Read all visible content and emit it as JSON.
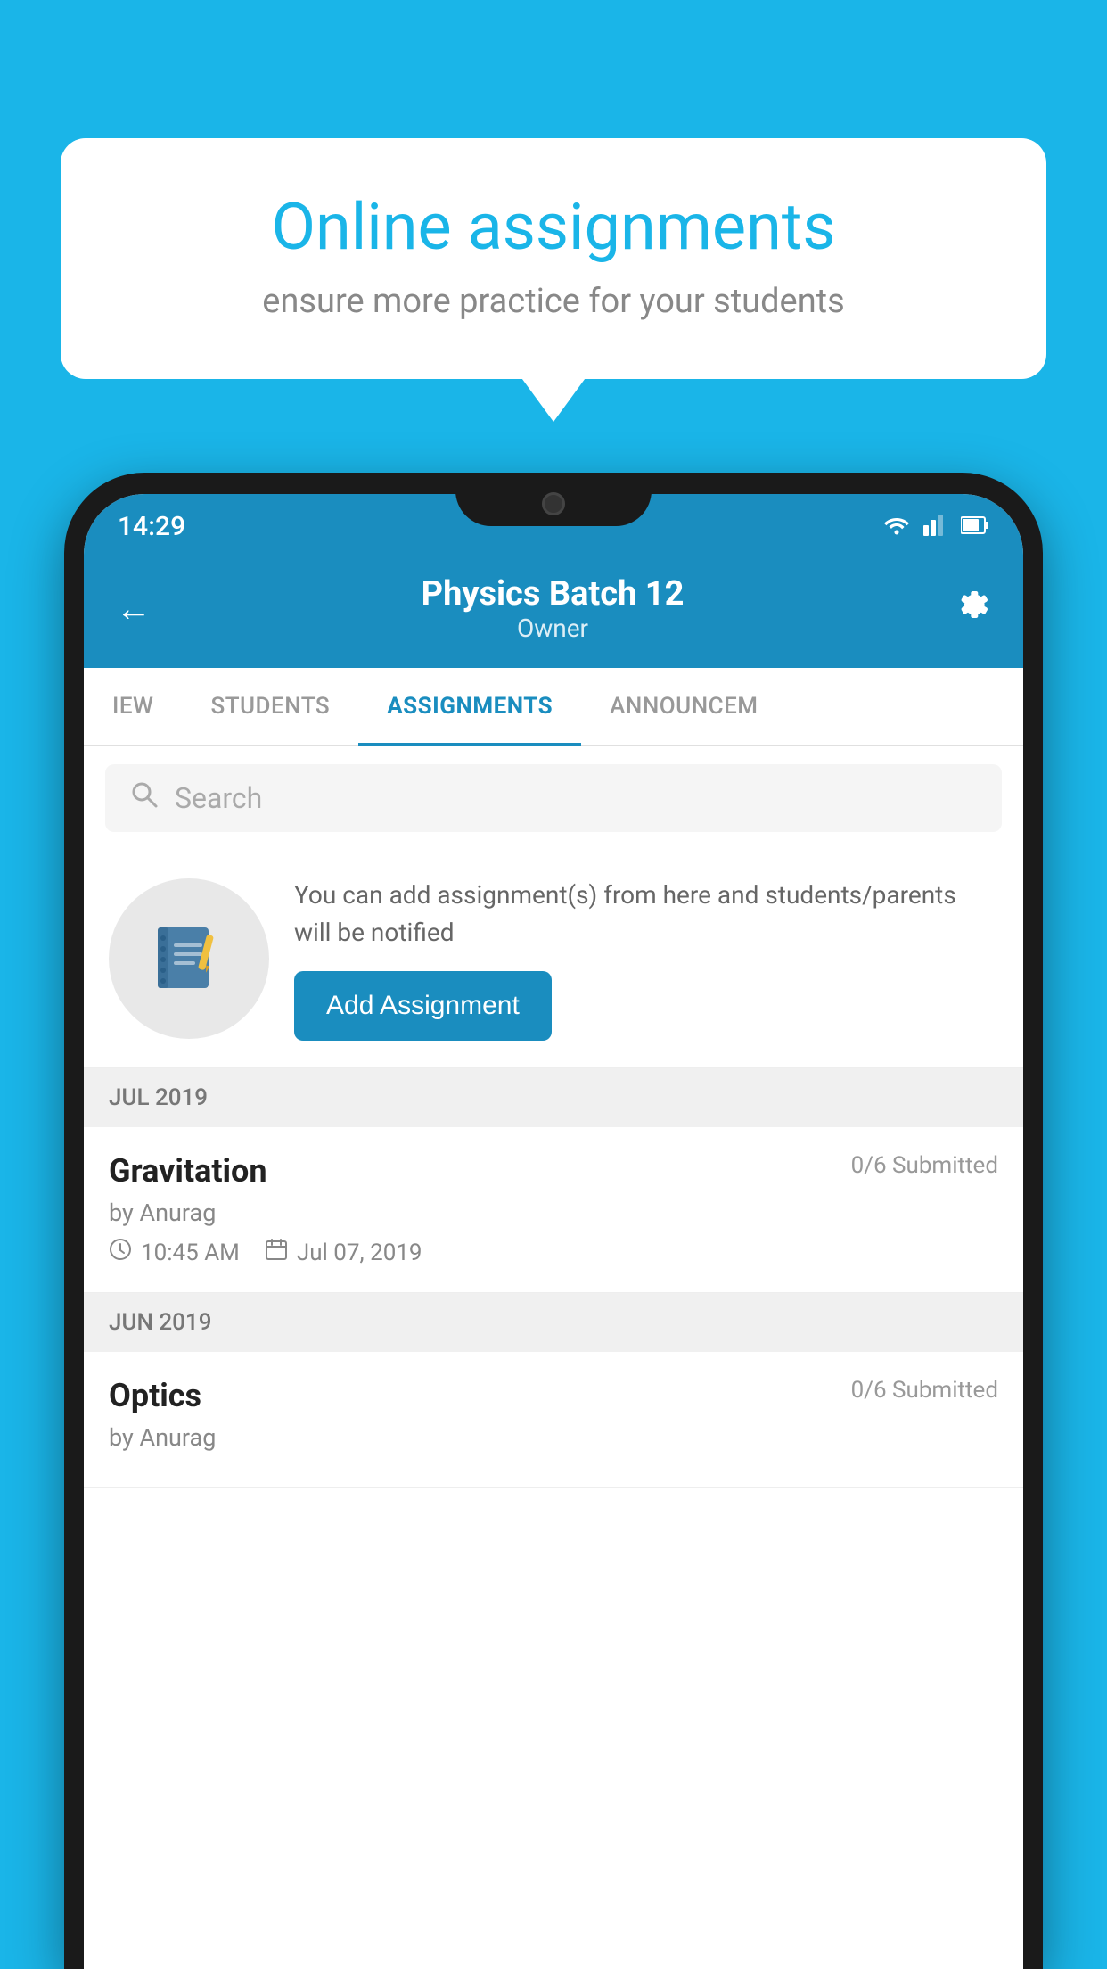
{
  "background_color": "#1ab5e8",
  "speech_bubble": {
    "title": "Online assignments",
    "subtitle": "ensure more practice for your students"
  },
  "phone": {
    "status_bar": {
      "time": "14:29",
      "icons": [
        "wifi",
        "signal",
        "battery"
      ]
    },
    "header": {
      "title": "Physics Batch 12",
      "subtitle": "Owner",
      "back_label": "←",
      "settings_label": "⚙"
    },
    "tabs": [
      {
        "label": "IEW",
        "active": false
      },
      {
        "label": "STUDENTS",
        "active": false
      },
      {
        "label": "ASSIGNMENTS",
        "active": true
      },
      {
        "label": "ANNOUNCEM",
        "active": false
      }
    ],
    "search": {
      "placeholder": "Search"
    },
    "promo": {
      "description": "You can add assignment(s) from here and students/parents will be notified",
      "button_label": "Add Assignment"
    },
    "months": [
      {
        "label": "JUL 2019",
        "assignments": [
          {
            "title": "Gravitation",
            "submitted": "0/6 Submitted",
            "by": "by Anurag",
            "time": "10:45 AM",
            "date": "Jul 07, 2019"
          }
        ]
      },
      {
        "label": "JUN 2019",
        "assignments": [
          {
            "title": "Optics",
            "submitted": "0/6 Submitted",
            "by": "by Anurag",
            "time": "",
            "date": ""
          }
        ]
      }
    ]
  }
}
